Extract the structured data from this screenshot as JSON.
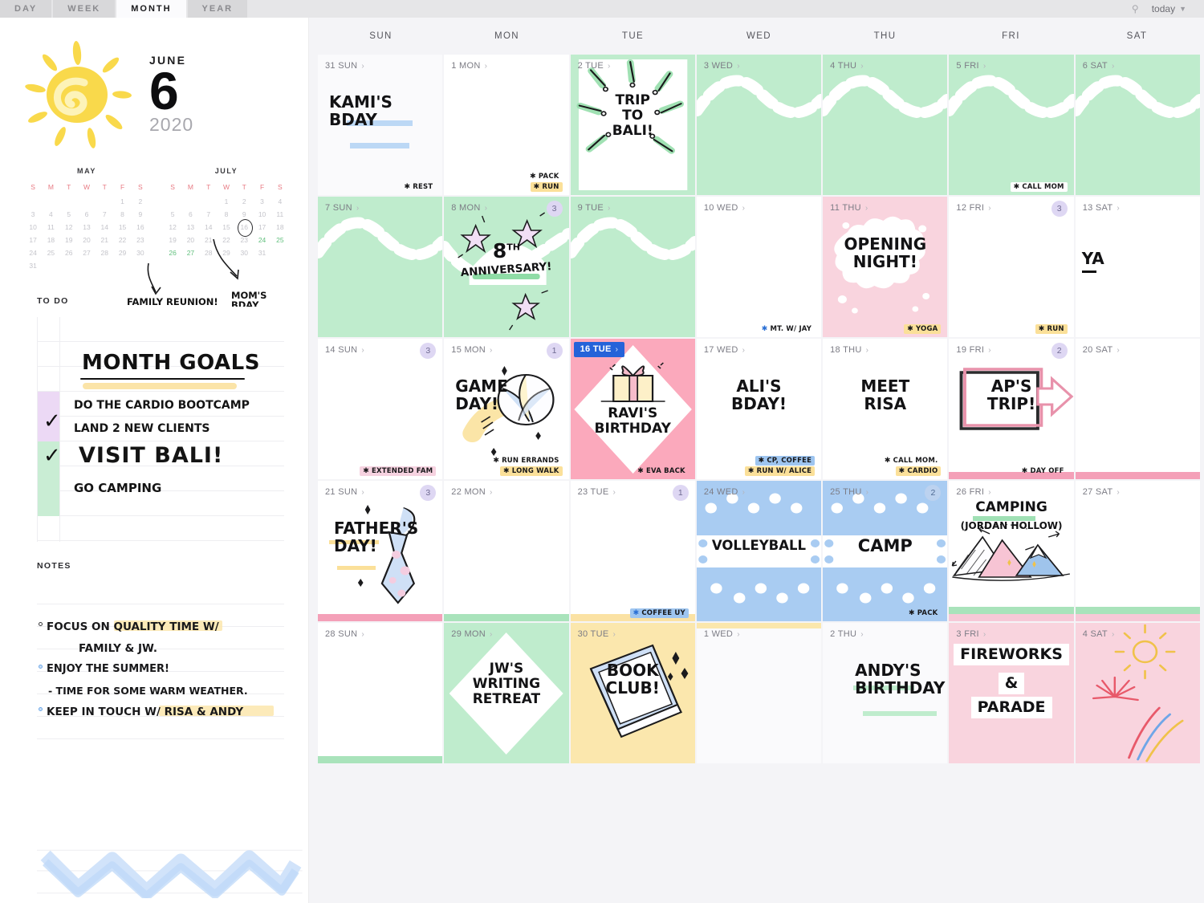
{
  "tabbar": {
    "tabs": [
      {
        "label": "DAY",
        "active": false
      },
      {
        "label": "WEEK",
        "active": false
      },
      {
        "label": "MONTH",
        "active": true
      },
      {
        "label": "YEAR",
        "active": false
      }
    ],
    "today_label": "today",
    "chevron_icon": "chevron-down-icon",
    "search_icon": "search-icon"
  },
  "sidebar": {
    "hero": {
      "sun_icon": "sun-icon",
      "month": "JUNE",
      "day": "6",
      "year": "2020"
    },
    "mini_calendars": [
      {
        "title": "MAY",
        "dow": [
          "S",
          "M",
          "T",
          "W",
          "T",
          "F",
          "S"
        ],
        "weeks": [
          [
            "",
            "",
            "",
            "",
            "",
            "1",
            "2"
          ],
          [
            "3",
            "4",
            "5",
            "6",
            "7",
            "8",
            "9"
          ],
          [
            "10",
            "11",
            "12",
            "13",
            "14",
            "15",
            "16"
          ],
          [
            "17",
            "18",
            "19",
            "20",
            "21",
            "22",
            "23"
          ],
          [
            "24",
            "25",
            "26",
            "27",
            "28",
            "29",
            "30"
          ],
          [
            "31",
            "",
            "",
            "",
            "",
            "",
            ""
          ]
        ],
        "highlighted": [],
        "circled": []
      },
      {
        "title": "JULY",
        "dow": [
          "S",
          "M",
          "T",
          "W",
          "T",
          "F",
          "S"
        ],
        "weeks": [
          [
            "",
            "",
            "",
            "1",
            "2",
            "3",
            "4"
          ],
          [
            "5",
            "6",
            "7",
            "8",
            "9",
            "10",
            "11"
          ],
          [
            "12",
            "13",
            "14",
            "15",
            "16",
            "17",
            "18"
          ],
          [
            "19",
            "20",
            "21",
            "22",
            "23",
            "24",
            "25"
          ],
          [
            "26",
            "27",
            "28",
            "29",
            "30",
            "31",
            ""
          ]
        ],
        "highlighted": [
          "24",
          "25",
          "26",
          "27"
        ],
        "circled": [
          "16"
        ]
      }
    ],
    "annotations": [
      {
        "text": "FAMILY REUNION!",
        "target": "26-27 July"
      },
      {
        "text": "MOM'S",
        "text2": "BDAY",
        "target": "16 July"
      }
    ],
    "todo": {
      "heading": "TO DO",
      "title": "MONTH GOALS",
      "items": [
        {
          "text": "DO THE CARDIO  BOOTCAMP",
          "checked": false,
          "size": "small",
          "swatch": "purple"
        },
        {
          "text": "LAND 2 NEW CLIENTS",
          "checked": true,
          "size": "small",
          "swatch": "purple"
        },
        {
          "text": "VISIT BALI!",
          "checked": true,
          "size": "large",
          "swatch": "green"
        },
        {
          "text": "GO CAMPING",
          "checked": false,
          "size": "small",
          "swatch": "green"
        }
      ]
    },
    "notes": {
      "heading": "NOTES",
      "lines": [
        {
          "bullet": "open",
          "text": "FOCUS ON QUALITY TIME W/",
          "highlight": "QUALITY TIME"
        },
        {
          "bullet": "none",
          "text": "FAMILY  &  JW.",
          "indent": true
        },
        {
          "bullet": "blue",
          "text": "ENJOY THE SUMMER!"
        },
        {
          "bullet": "dash",
          "text": "- TIME FOR SOME WARM WEATHER."
        },
        {
          "bullet": "blue",
          "text": "KEEP IN TOUCH W/ RISA & ANDY",
          "highlight": "RISA & ANDY"
        }
      ]
    }
  },
  "calendar": {
    "day_headers": [
      "SUN",
      "MON",
      "TUE",
      "WED",
      "THU",
      "FRI",
      "SAT"
    ],
    "chevron_icon": "chevron-right-icon",
    "weeks": [
      [
        {
          "date": "31 SUN",
          "dim": true,
          "hw": [
            "KAMI'S",
            "BDAY"
          ],
          "hw_underline": "blue",
          "tasks": [
            {
              "text": "REST",
              "star": "dark"
            }
          ]
        },
        {
          "date": "1 MON",
          "tasks": [
            {
              "text": "PACK",
              "star": "dark"
            },
            {
              "text": "RUN",
              "star": "dark",
              "hl": "yellow"
            }
          ]
        },
        {
          "date": "2 TUE",
          "bg": "green",
          "art": "bali-burst",
          "hw": [
            "TRIP",
            "TO",
            "BALI!"
          ]
        },
        {
          "date": "3 WED",
          "bg": "green",
          "art": "wave"
        },
        {
          "date": "4 THU",
          "bg": "green",
          "art": "wave"
        },
        {
          "date": "5 FRI",
          "bg": "green",
          "art": "wave",
          "tasks": [
            {
              "text": "CALL MOM",
              "star": "dark",
              "chipwhite": true
            }
          ]
        },
        {
          "date": "6 SAT",
          "bg": "green",
          "art": "wave"
        }
      ],
      [
        {
          "date": "7 SUN",
          "bg": "green",
          "art": "wave"
        },
        {
          "date": "8 MON",
          "bg": "green",
          "art": "wave-sparkle",
          "badge": "3",
          "hw": [
            "8",
            "TH",
            "ANNIVERSARY!"
          ],
          "hw_style": "anniversary"
        },
        {
          "date": "9 TUE",
          "bg": "green",
          "art": "wave"
        },
        {
          "date": "10 WED",
          "tasks": [
            {
              "text": "MT. W/ JAY",
              "star": "blue"
            }
          ]
        },
        {
          "date": "11 THU",
          "bg": "pink",
          "art": "cloud",
          "hw": [
            "OPENING",
            "NIGHT!"
          ],
          "tasks": [
            {
              "text": "YOGA",
              "star": "dark",
              "hl": "yellow"
            }
          ]
        },
        {
          "date": "12 FRI",
          "badge": "3",
          "tasks": [
            {
              "text": "RUN",
              "star": "dark",
              "hl": "yellow"
            }
          ]
        },
        {
          "date": "13 SAT",
          "hw": [
            "YA"
          ],
          "hw_cut": true
        }
      ],
      [
        {
          "date": "14 SUN",
          "badge": "3",
          "tasks": [
            {
              "text": "EXTENDED FAM",
              "star": "dark",
              "hl": "pink"
            }
          ]
        },
        {
          "date": "15 MON",
          "badge": "1",
          "hw": [
            "GAME",
            "DAY!"
          ],
          "art": "volleyball",
          "tasks": [
            {
              "text": "RUN ERRANDS",
              "star": "dark"
            },
            {
              "text": "LONG WALK",
              "star": "dark",
              "hl": "yellow"
            }
          ]
        },
        {
          "date": "16 TUE",
          "selected": true,
          "bg": "pinkd",
          "art": "gift-diamond",
          "hw": [
            "RAVI'S",
            "BIRTHDAY"
          ],
          "tasks": [
            {
              "text": "EVA BACK",
              "star": "dark"
            }
          ]
        },
        {
          "date": "17 WED",
          "hw": [
            "ALI'S",
            "BDAY!"
          ],
          "tasks": [
            {
              "text": "CP, COFFEE",
              "star": "dark",
              "hl": "blue"
            },
            {
              "text": "RUN W/ ALICE",
              "star": "dark",
              "hl": "yellow"
            }
          ]
        },
        {
          "date": "18 THU",
          "hw": [
            "MEET",
            "RISA"
          ],
          "tasks": [
            {
              "text": "CALL MOM.",
              "star": "dark"
            },
            {
              "text": "CARDIO",
              "star": "dark",
              "hl": "yellow"
            }
          ]
        },
        {
          "date": "19 FRI",
          "badge": "2",
          "art": "arrow-box",
          "hw": [
            "AP'S",
            "TRIP!"
          ],
          "strip": "pink",
          "tasks": [
            {
              "text": "DAY OFF",
              "star": "dark"
            }
          ]
        },
        {
          "date": "20 SAT",
          "strip": "pink"
        }
      ],
      [
        {
          "date": "21 SUN",
          "badge": "3",
          "hw": [
            "FATHER'S",
            "DAY!"
          ],
          "art": "necktie",
          "strip": "pink"
        },
        {
          "date": "22 MON",
          "strip": "green"
        },
        {
          "date": "23 TUE",
          "badge": "1",
          "strip": "yellow",
          "tasks": [
            {
              "text": "COFFEE UY",
              "star": "blue",
              "hl": "blue"
            }
          ]
        },
        {
          "date": "24 WED",
          "bg": "blue",
          "art": "dots-band",
          "hw": [
            "VOLLEYBALL"
          ]
        },
        {
          "date": "25 THU",
          "bg": "blue",
          "art": "dots-band",
          "badge": "2",
          "badge_blue": true,
          "hw": [
            "CAMP"
          ],
          "tasks": [
            {
              "text": "PACK",
              "star": "dark"
            }
          ]
        },
        {
          "date": "26 FRI",
          "hw": [
            "CAMPING",
            "(JORDAN HOLLOW)"
          ],
          "art": "mountains",
          "strip": "greenpink"
        },
        {
          "date": "27 SAT",
          "strip": "greenpink"
        }
      ],
      [
        {
          "date": "28 SUN",
          "strip": "green"
        },
        {
          "date": "29 MON",
          "bg": "green",
          "art": "diamond",
          "hw": [
            "JW'S",
            "WRITING",
            "RETREAT"
          ]
        },
        {
          "date": "30 TUE",
          "bg": "yellow",
          "art": "book",
          "hw": [
            "BOOK",
            "CLUB!"
          ]
        },
        {
          "date": "1 WED",
          "dim": true,
          "topstrip": "yellow"
        },
        {
          "date": "2 THU",
          "dim": true,
          "hw": [
            "ANDY'S",
            "BIRTHDAY!"
          ],
          "hw_underline": "green"
        },
        {
          "date": "3 FRI",
          "bg": "pink",
          "hw": [
            "FIREWORKS",
            "&",
            "PARADE"
          ],
          "hw_style": "chips"
        },
        {
          "date": "4 SAT",
          "bg": "pink",
          "art": "firework"
        }
      ]
    ]
  },
  "colors": {
    "accent_blue": "#2563d9",
    "green": "#bfeccd",
    "pink": "#f9d4de",
    "pink_deep": "#fba9bc",
    "blue": "#a9ccf2",
    "yellow": "#fbe7ad",
    "badge_purple": "#ded7f3",
    "sun_yellow": "#f9d949"
  }
}
